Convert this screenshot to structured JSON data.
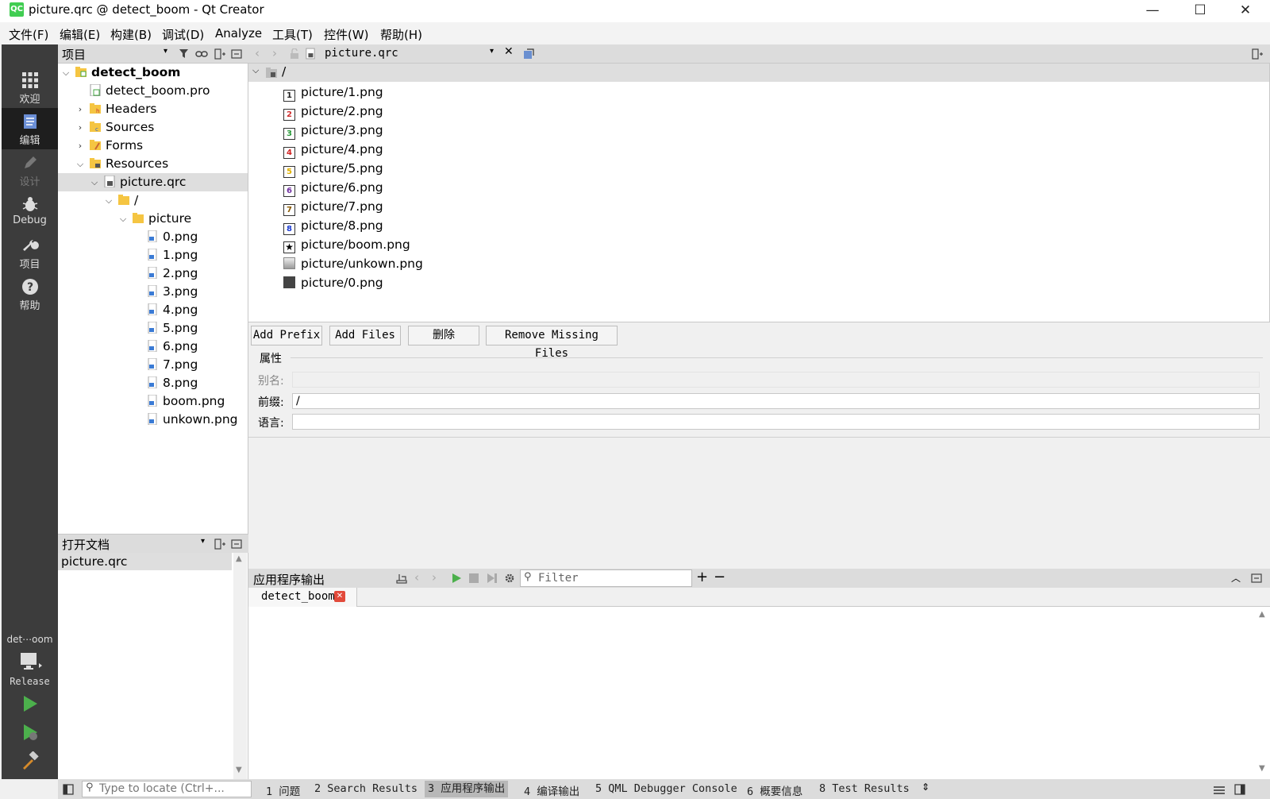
{
  "window": {
    "title": "picture.qrc @ detect_boom - Qt Creator",
    "app_icon_text": "QC",
    "minimize": "—",
    "maximize": "☐",
    "close": "✕"
  },
  "menu": [
    "文件(F)",
    "编辑(E)",
    "构建(B)",
    "调试(D)",
    "Analyze",
    "工具(T)",
    "控件(W)",
    "帮助(H)"
  ],
  "modes": [
    {
      "label": "欢迎",
      "icon": "grid-icon"
    },
    {
      "label": "编辑",
      "icon": "edit-doc-icon"
    },
    {
      "label": "设计",
      "icon": "pencil-icon"
    },
    {
      "label": "Debug",
      "icon": "bug-icon"
    },
    {
      "label": "项目",
      "icon": "wrench-icon"
    },
    {
      "label": "帮助",
      "icon": "help-icon"
    }
  ],
  "kit": {
    "project": "det⋯oom",
    "config": "Release"
  },
  "project_pane": {
    "title": "项目",
    "tree": [
      {
        "label": "detect_boom",
        "bold": true
      },
      {
        "label": "detect_boom.pro"
      },
      {
        "label": "Headers"
      },
      {
        "label": "Sources"
      },
      {
        "label": "Forms"
      },
      {
        "label": "Resources"
      },
      {
        "label": "picture.qrc"
      },
      {
        "label": "/"
      },
      {
        "label": "picture"
      },
      {
        "label": "0.png"
      },
      {
        "label": "1.png"
      },
      {
        "label": "2.png"
      },
      {
        "label": "3.png"
      },
      {
        "label": "4.png"
      },
      {
        "label": "5.png"
      },
      {
        "label": "6.png"
      },
      {
        "label": "7.png"
      },
      {
        "label": "8.png"
      },
      {
        "label": "boom.png"
      },
      {
        "label": "unkown.png"
      }
    ]
  },
  "open_docs": {
    "title": "打开文档",
    "items": [
      "picture.qrc"
    ]
  },
  "editor": {
    "tab_file": "picture.qrc",
    "prefix": "/",
    "resources": [
      {
        "name": "picture/1.png",
        "badge": "1",
        "color": "#222222"
      },
      {
        "name": "picture/2.png",
        "badge": "2",
        "color": "#d03030"
      },
      {
        "name": "picture/3.png",
        "badge": "3",
        "color": "#2a9a3a"
      },
      {
        "name": "picture/4.png",
        "badge": "4",
        "color": "#d02020"
      },
      {
        "name": "picture/5.png",
        "badge": "5",
        "color": "#e0b000"
      },
      {
        "name": "picture/6.png",
        "badge": "6",
        "color": "#7030a0"
      },
      {
        "name": "picture/7.png",
        "badge": "7",
        "color": "#8a5a00"
      },
      {
        "name": "picture/8.png",
        "badge": "8",
        "color": "#1a3ad0"
      },
      {
        "name": "picture/boom.png",
        "badge": "★",
        "color": "#000000"
      },
      {
        "name": "picture/unkown.png",
        "badge": "",
        "color": "#aaaaaa"
      },
      {
        "name": "picture/0.png",
        "badge": "",
        "color": "#444444"
      }
    ],
    "buttons": {
      "add_prefix": "Add Prefix",
      "add_files": "Add Files",
      "delete": "删除",
      "remove_missing": "Remove Missing Files"
    },
    "properties": {
      "title": "属性",
      "alias_label": "别名:",
      "alias_value": "",
      "prefix_label": "前缀:",
      "prefix_value": "/",
      "lang_label": "语言:",
      "lang_value": ""
    }
  },
  "output": {
    "title": "应用程序输出",
    "filter_placeholder": "Filter",
    "tab": "detect_boom"
  },
  "statusbar": {
    "locate_placeholder": "Type to locate (Ctrl+...",
    "tabs": [
      "1 问题",
      "2 Search Results",
      "3 应用程序输出",
      "4 编译输出",
      "5 QML Debugger Console",
      "6 概要信息",
      "8 Test Results"
    ]
  }
}
